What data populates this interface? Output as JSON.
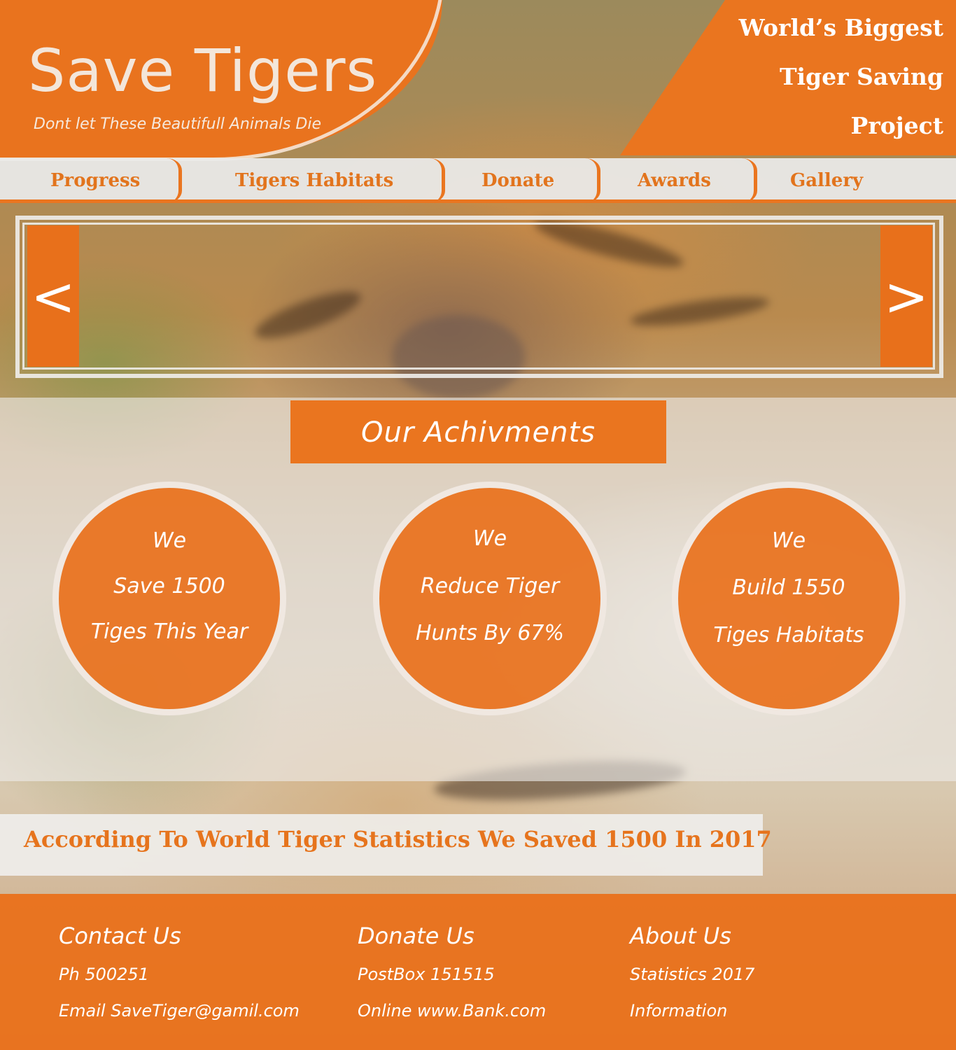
{
  "header": {
    "title": "Save Tigers",
    "tagline": "Dont let These Beautifull Animals Die",
    "slogan": [
      "World’s Biggest",
      "Tiger Saving",
      "Project"
    ]
  },
  "nav": {
    "items": [
      {
        "label": "Progress"
      },
      {
        "label": "Tigers Habitats"
      },
      {
        "label": "Donate"
      },
      {
        "label": "Awards"
      },
      {
        "label": "Gallery"
      }
    ]
  },
  "slider": {
    "prev_icon": "chevron-left-icon",
    "next_icon": "chevron-right-icon",
    "prev_glyph": "<",
    "next_glyph": ">"
  },
  "achievements": {
    "heading": "Our Achivments",
    "cards": [
      {
        "lines": [
          "We",
          "Save 1500",
          "Tiges This Year"
        ]
      },
      {
        "lines": [
          "We",
          "Reduce Tiger",
          "Hunts By 67%"
        ]
      },
      {
        "lines": [
          "We",
          "Build 1550",
          "Tiges Habitats"
        ]
      }
    ]
  },
  "statistic": {
    "text": "According To World Tiger Statistics We Saved 1500 In 2017"
  },
  "footer": {
    "contact": {
      "heading": "Contact Us",
      "phone": "Ph 500251",
      "email": "Email SaveTiger@gamil.com"
    },
    "donate": {
      "heading": "Donate Us",
      "postbox": "PostBox 151515",
      "online": "Online www.Bank.com"
    },
    "about": {
      "heading": "About Us",
      "statistics": "Statistics 2017",
      "information": "Information"
    }
  },
  "colors": {
    "accent": "#ea751f",
    "nav_bg": "#ebebeb",
    "text_light": "#ffffff"
  }
}
